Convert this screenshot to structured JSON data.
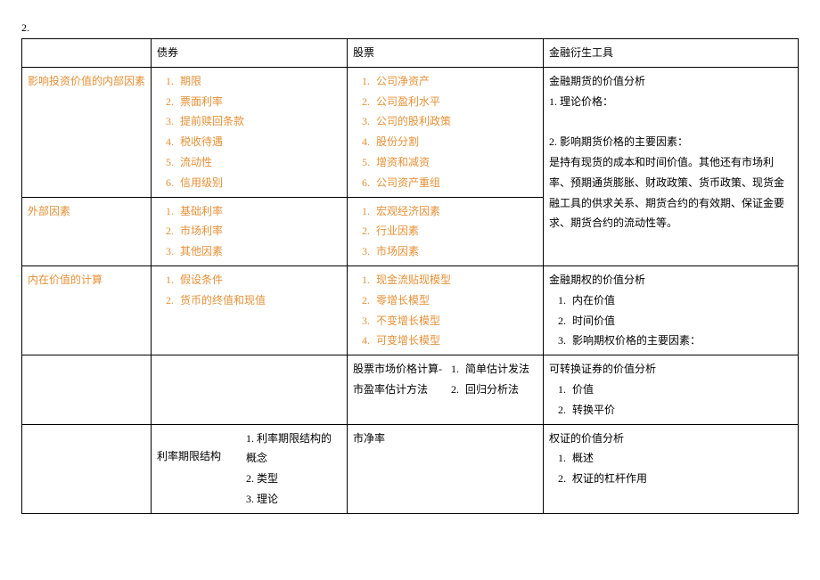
{
  "page_number": "2.",
  "header": {
    "col1": "",
    "col2": "债券",
    "col3": "股票",
    "col4": "金融衍生工具"
  },
  "row1": {
    "label": "影响投资价值的内部因素",
    "bonds": [
      "期限",
      "票面利率",
      "提前赎回条款",
      "税收待遇",
      "流动性",
      "信用级别"
    ],
    "stocks": [
      "公司净资产",
      "公司盈利水平",
      "公司的股利政策",
      "股份分割",
      "增资和减资",
      "公司资产重组"
    ]
  },
  "row2": {
    "label": "外部因素",
    "bonds": [
      "基础利率",
      "市场利率",
      "其他因素"
    ],
    "stocks": [
      "宏观经济因素",
      "行业因素",
      "市场因素"
    ]
  },
  "deriv_block1": {
    "title": "金融期货的价值分析",
    "line1": "1. 理论价格：",
    "line2": "2. 影响期货价格的主要因素：",
    "body": "是持有现货的成本和时间价值。其他还有市场利率、预期通货膨胀、财政政策、货币政策、现货金融工具的供求关系、期货合约的有效期、保证金要求、期货合约的流动性等。"
  },
  "row3": {
    "label": "内在价值的计算",
    "bonds": [
      "假设条件",
      "货币的终值和现值"
    ],
    "stocks": [
      "现金流贴现模型",
      "零增长模型",
      "不变增长模型",
      "可变增长模型"
    ],
    "deriv_title": "金融期权的价值分析",
    "deriv_items": [
      "内在价值",
      "时间价值",
      "影响期权价格的主要因素："
    ]
  },
  "row4": {
    "stocks_left": "股票市场价格计算-市盈率估计方法",
    "stocks_right": [
      "简单估计发法",
      "回归分析法"
    ],
    "deriv_title": "可转换证券的价值分析",
    "deriv_items": [
      "价值",
      "转换平价"
    ]
  },
  "row5": {
    "bonds_left": "利率期限结构",
    "bonds_right": [
      "利率期限结构的概念",
      "类型",
      "理论"
    ],
    "stocks": "市净率",
    "deriv_title": "权证的价值分析",
    "deriv_items": [
      "概述",
      "权证的杠杆作用"
    ]
  }
}
